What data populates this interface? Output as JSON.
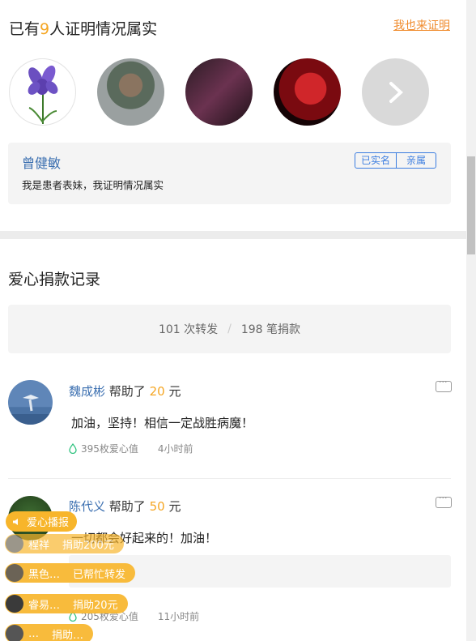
{
  "proof": {
    "prefix": "已有",
    "count": "9",
    "suffix": "人证明情况属实",
    "link": "我也来证明",
    "avatars": [
      "avatar-iris-flower",
      "avatar-man-portrait",
      "avatar-car-interior",
      "avatar-red-concert"
    ],
    "more_icon": "chevron-right-icon",
    "prover": {
      "name": "曾健敏",
      "text": "我是患者表妹，我证明情况属实",
      "tags": [
        "已实名",
        "亲属"
      ]
    }
  },
  "records": {
    "title": "爱心捐款记录",
    "shares": "101 次转发",
    "separator": "/",
    "donations": "198 笔捐款",
    "entries": [
      {
        "name": "魏成彬",
        "helped": "帮助了",
        "amount": "20",
        "unit": "元",
        "message": "加油，坚持！相信一定战胜病魔！",
        "love": "395枚爱心值",
        "time": "4小时前"
      },
      {
        "name": "陈代义",
        "helped": "帮助了",
        "amount": "50",
        "unit": "元",
        "message": "一切都会好起来的！加油！",
        "love": "205枚爱心值",
        "time": "11小时前"
      }
    ]
  },
  "broadcast": {
    "label": "爱心播报",
    "toasts": [
      {
        "user": "程祥",
        "action": "捐助200元"
      },
      {
        "user": "黑色…",
        "action": "已帮忙转发"
      },
      {
        "user": "睿易…",
        "action": "捐助20元"
      },
      {
        "user": "…",
        "action": "捐助…"
      }
    ]
  },
  "colors": {
    "accent": "#f5a623",
    "link": "#3b6fb0",
    "tag": "#3b7de0",
    "broadcast": "#f7b52b"
  }
}
